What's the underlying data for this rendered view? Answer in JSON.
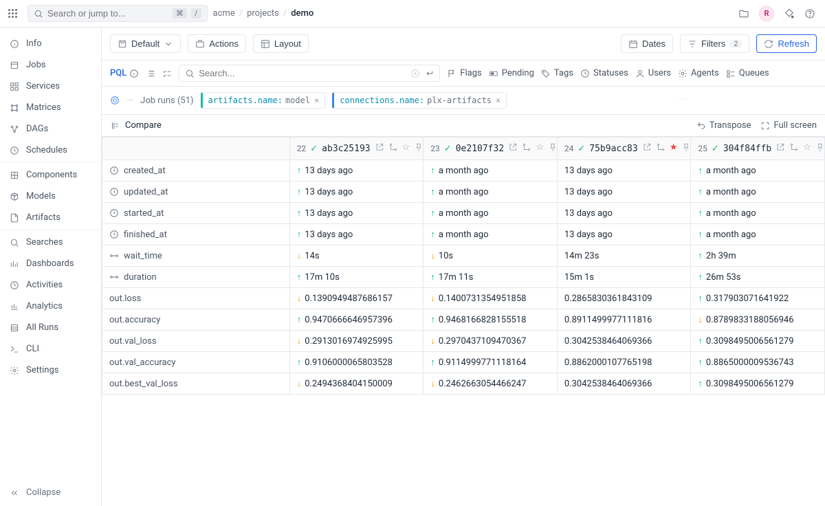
{
  "search": {
    "placeholder": "Search or jump to...",
    "kbd1": "⌘",
    "kbd2": "/"
  },
  "breadcrumb": [
    "acme",
    "projects",
    "demo"
  ],
  "avatar": "R",
  "sidebar": {
    "items": [
      "Info",
      "Jobs",
      "Services",
      "Matrices",
      "DAGs",
      "Schedules",
      "Components",
      "Models",
      "Artifacts",
      "Searches",
      "Dashboards",
      "Activities",
      "Analytics",
      "All Runs",
      "CLI",
      "Settings"
    ],
    "collapse": "Collapse"
  },
  "toolbar": {
    "default": "Default",
    "actions": "Actions",
    "layout": "Layout",
    "dates": "Dates",
    "filters": "Filters",
    "filters_count": "2",
    "refresh": "Refresh"
  },
  "filterbar": {
    "pql": "PQL",
    "search_placeholder": "Search...",
    "flags": "Flags",
    "pending": "Pending",
    "tags": "Tags",
    "statuses": "Statuses",
    "users": "Users",
    "agents": "Agents",
    "queues": "Queues"
  },
  "chipbar": {
    "label": "Job runs (51)",
    "chip1_key": "artifacts.name:",
    "chip1_val": " model",
    "chip2_key": "connections.name:",
    "chip2_val": " plx-artifacts"
  },
  "comparebar": {
    "compare": "Compare",
    "transpose": "Transpose",
    "fullscreen": "Full screen"
  },
  "runs": [
    {
      "num": "22",
      "hash": "ab3c25193"
    },
    {
      "num": "23",
      "hash": "0e2107f32"
    },
    {
      "num": "24",
      "hash": "75b9acc83"
    },
    {
      "num": "25",
      "hash": "304f84ffb"
    }
  ],
  "rows": [
    {
      "label": "created_at",
      "icon": "clock",
      "cells": [
        {
          "t": "13 days ago",
          "d": "up"
        },
        {
          "t": "a month ago",
          "d": "up"
        },
        {
          "t": "13 days ago",
          "d": ""
        },
        {
          "t": "a month ago",
          "d": "up"
        }
      ]
    },
    {
      "label": "updated_at",
      "icon": "clock",
      "cells": [
        {
          "t": "13 days ago",
          "d": "up"
        },
        {
          "t": "a month ago",
          "d": "up"
        },
        {
          "t": "13 days ago",
          "d": ""
        },
        {
          "t": "a month ago",
          "d": "up"
        }
      ]
    },
    {
      "label": "started_at",
      "icon": "clock",
      "cells": [
        {
          "t": "13 days ago",
          "d": "up"
        },
        {
          "t": "a month ago",
          "d": "up"
        },
        {
          "t": "13 days ago",
          "d": ""
        },
        {
          "t": "a month ago",
          "d": "up"
        }
      ]
    },
    {
      "label": "finished_at",
      "icon": "clock",
      "cells": [
        {
          "t": "13 days ago",
          "d": "up"
        },
        {
          "t": "a month ago",
          "d": "up"
        },
        {
          "t": "13 days ago",
          "d": ""
        },
        {
          "t": "a month ago",
          "d": "up"
        }
      ]
    },
    {
      "label": "wait_time",
      "icon": "timeline",
      "cells": [
        {
          "t": "14s",
          "d": "down"
        },
        {
          "t": "10s",
          "d": "down"
        },
        {
          "t": "14m 23s",
          "d": ""
        },
        {
          "t": "2h 39m",
          "d": "up"
        }
      ]
    },
    {
      "label": "duration",
      "icon": "timeline",
      "cells": [
        {
          "t": "17m 10s",
          "d": "up"
        },
        {
          "t": "17m 11s",
          "d": "up"
        },
        {
          "t": "15m 1s",
          "d": ""
        },
        {
          "t": "26m 53s",
          "d": "up"
        }
      ]
    },
    {
      "label": "out.loss",
      "icon": "",
      "cells": [
        {
          "t": "0.1390949487686157",
          "d": "down"
        },
        {
          "t": "0.1400731354951858",
          "d": "down"
        },
        {
          "t": "0.2865830361843109",
          "d": ""
        },
        {
          "t": "0.317903071641922",
          "d": "up"
        }
      ]
    },
    {
      "label": "out.accuracy",
      "icon": "",
      "cells": [
        {
          "t": "0.9470666646957396",
          "d": "up"
        },
        {
          "t": "0.9468166828155518",
          "d": "up"
        },
        {
          "t": "0.8911499977111816",
          "d": ""
        },
        {
          "t": "0.8789833188056946",
          "d": "down"
        }
      ]
    },
    {
      "label": "out.val_loss",
      "icon": "",
      "cells": [
        {
          "t": "0.2913016974925995",
          "d": "down"
        },
        {
          "t": "0.2970437109470367",
          "d": "down"
        },
        {
          "t": "0.3042538464069366",
          "d": ""
        },
        {
          "t": "0.3098495006561279",
          "d": "up"
        }
      ]
    },
    {
      "label": "out.val_accuracy",
      "icon": "",
      "cells": [
        {
          "t": "0.9106000065803528",
          "d": "up"
        },
        {
          "t": "0.9114999771118164",
          "d": "up"
        },
        {
          "t": "0.8862000107765198",
          "d": ""
        },
        {
          "t": "0.8865000009536743",
          "d": "up"
        }
      ]
    },
    {
      "label": "out.best_val_loss",
      "icon": "",
      "cells": [
        {
          "t": "0.2494368404150009",
          "d": "down"
        },
        {
          "t": "0.2462663054466247",
          "d": "down"
        },
        {
          "t": "0.3042538464069366",
          "d": ""
        },
        {
          "t": "0.3098495006561279",
          "d": "up"
        }
      ]
    }
  ]
}
